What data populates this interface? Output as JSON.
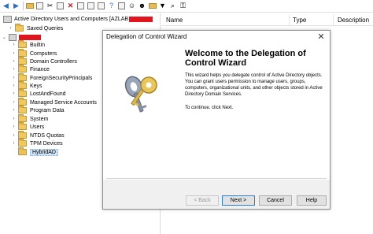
{
  "toolbar": {
    "icons": [
      "back-arrow-icon",
      "forward-arrow-icon",
      "up-folder-icon",
      "console-tree-icon",
      "cut-icon",
      "copy-icon",
      "delete-icon",
      "properties-icon",
      "refresh-icon",
      "export-icon",
      "help-icon",
      "mmc-icon",
      "new-user-icon",
      "new-group-icon",
      "new-ou-icon",
      "filter-icon",
      "find-icon",
      "delegate-icon"
    ]
  },
  "tree": {
    "root_label": "Active Directory Users and Computers [AZLAB",
    "saved_queries": "Saved Queries",
    "items": [
      "Builtin",
      "Computers",
      "Domain Controllers",
      "Finance",
      "ForeignSecurityPrincipals",
      "Keys",
      "LostAndFound",
      "Managed Service Accounts",
      "Program Data",
      "System",
      "Users",
      "NTDS Quotas",
      "TPM Devices",
      "HybridAD"
    ],
    "selected": "HybridAD"
  },
  "list": {
    "columns": [
      "Name",
      "Type",
      "Description"
    ]
  },
  "dialog": {
    "title": "Delegation of Control Wizard",
    "close": "✕",
    "heading": "Welcome to the Delegation of Control Wizard",
    "description": "This wizard helps you delegate control of Active Directory objects. You can grant users permission to manage users, groups, computers, organizational units, and other objects stored in Active Directory Domain Services.",
    "continue_text": "To continue, click Next.",
    "buttons": {
      "back": "< Back",
      "next": "Next >",
      "cancel": "Cancel",
      "help": "Help"
    }
  },
  "colors": {
    "redaction": "#e0151e",
    "folder": "#f1c85d",
    "selection": "#cce4f7"
  }
}
